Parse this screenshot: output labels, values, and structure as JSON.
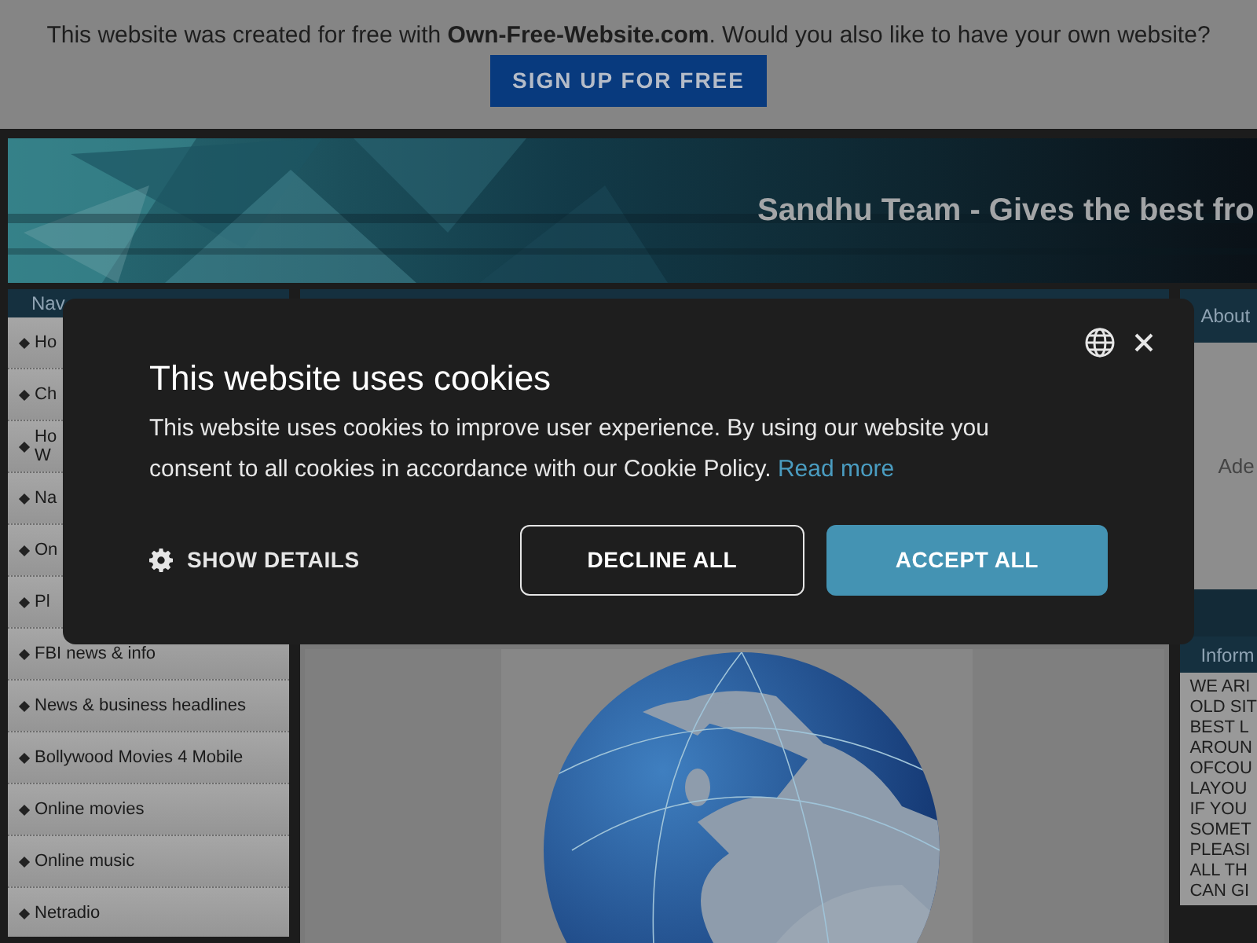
{
  "promo_bar": {
    "text": "This website was created for free with **Own-Free-Website.com**. Would you also like to have your own website?",
    "button": "SIGN UP FOR FREE"
  },
  "header": {
    "title": "Sandhu Team - Gives the best fro"
  },
  "left_nav": {
    "title": "Nav",
    "items": [
      {
        "label": "Ho"
      },
      {
        "label": "Ch"
      },
      {
        "label": "Ho\nW"
      },
      {
        "label": "Na"
      },
      {
        "label": "On"
      },
      {
        "label": "Pl"
      },
      {
        "label": "FBI news & info"
      },
      {
        "label": "News & business headlines"
      },
      {
        "label": "Bollywood Movies 4 Mobile"
      },
      {
        "label": "Online movies"
      },
      {
        "label": "Online music"
      },
      {
        "label": "Netradio"
      }
    ]
  },
  "right_column": {
    "about_title": "About",
    "about_text": "Ade",
    "info_title": "Inform",
    "info_lines": [
      "WE ARI",
      "OLD SIT",
      "BEST L",
      "AROUN",
      "OFCOU",
      "LAYOU",
      "IF YOU",
      "SOMET",
      "PLEASI",
      "ALL TH",
      "CAN GI"
    ]
  },
  "cookie_dialog": {
    "title": "This website uses cookies",
    "text": "This website uses cookies to improve user experience. By using our website you consent to all cookies in accordance with our Cookie Policy.",
    "read_more": "Read more",
    "show_details": "SHOW DETAILS",
    "decline": "DECLINE ALL",
    "accept": "ACCEPT ALL"
  }
}
